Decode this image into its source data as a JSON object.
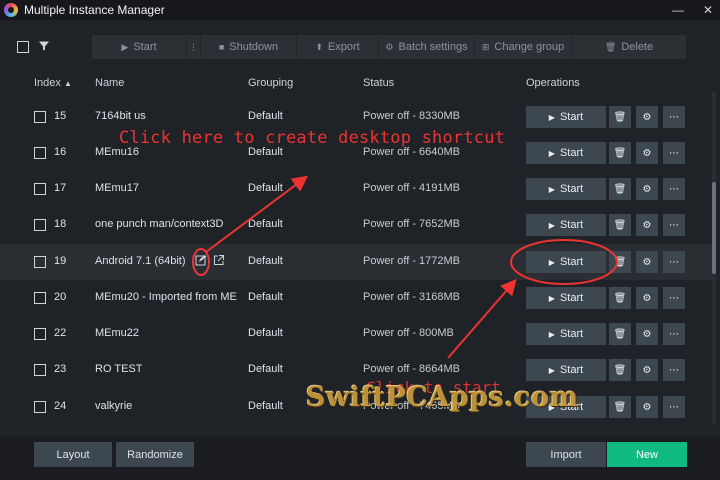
{
  "window": {
    "title": "Multiple Instance Manager"
  },
  "toolbar": {
    "start": "Start",
    "shutdown": "Shutdown",
    "export": "Export",
    "batch_settings": "Batch settings",
    "change_group": "Change group",
    "delete": "Delete"
  },
  "table": {
    "headers": {
      "index": "Index",
      "name": "Name",
      "grouping": "Grouping",
      "status": "Status",
      "operations": "Operations"
    },
    "start_label": "Start",
    "rows": [
      {
        "index": "15",
        "name": "7164bit us",
        "grouping": "Default",
        "status": "Power off - 8330MB"
      },
      {
        "index": "16",
        "name": "MEmu16",
        "grouping": "Default",
        "status": "Power off - 6640MB"
      },
      {
        "index": "17",
        "name": "MEmu17",
        "grouping": "Default",
        "status": "Power off - 4191MB"
      },
      {
        "index": "18",
        "name": "one punch man/context3D",
        "grouping": "Default",
        "status": "Power off - 7652MB"
      },
      {
        "index": "19",
        "name": "Android 7.1 (64bit)",
        "grouping": "Default",
        "status": "Power off - 1772MB"
      },
      {
        "index": "20",
        "name": "MEmu20 - Imported from ME",
        "grouping": "Default",
        "status": "Power off - 3168MB"
      },
      {
        "index": "22",
        "name": "MEmu22",
        "grouping": "Default",
        "status": "Power off - 800MB"
      },
      {
        "index": "23",
        "name": "RO TEST",
        "grouping": "Default",
        "status": "Power off - 8664MB"
      },
      {
        "index": "24",
        "name": "valkyrie",
        "grouping": "Default",
        "status": "Power off - 7465MB"
      }
    ]
  },
  "bottom": {
    "layout": "Layout",
    "randomize": "Randomize",
    "import": "Import",
    "new": "New"
  },
  "annotations": {
    "shortcut_hint": "Click here to create desktop shortcut",
    "start_hint": "Click to start",
    "watermark": "SwiftPCApps.com"
  },
  "colors": {
    "accent_new": "#11b982",
    "annotation_red": "#ee3333",
    "button_bg": "#3d4750",
    "background": "#1f2226"
  },
  "icons": {
    "select_all": "checkbox-icon",
    "filter": "filter-icon",
    "edit_name": "edit-icon",
    "shortcut": "external-link-icon"
  }
}
